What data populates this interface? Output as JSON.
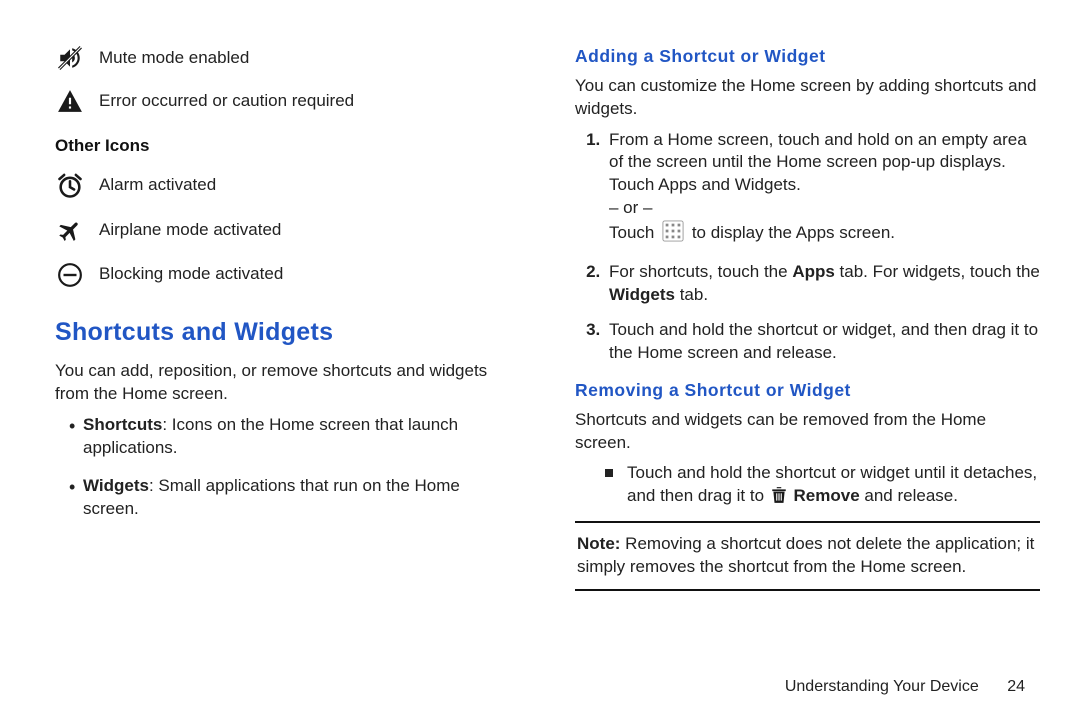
{
  "left": {
    "muteRow": "Mute mode enabled",
    "errorRow": "Error occurred or caution required",
    "otherHeading": "Other Icons",
    "alarmRow": "Alarm activated",
    "airplaneRow": "Airplane mode activated",
    "blockingRow": "Blocking mode activated",
    "shortcutHeading": "Shortcuts and Widgets",
    "shortcutIntro": "You can add, reposition, or remove shortcuts and widgets from the Home screen.",
    "bullet1_b": "Shortcuts",
    "bullet1_t": ": Icons on the Home screen that launch applications.",
    "bullet2_b": "Widgets",
    "bullet2_t": ": Small applications that run on the Home screen."
  },
  "right": {
    "addHeading": "Adding a Shortcut or Widget",
    "addIntro": "You can customize the Home screen by adding shortcuts and widgets.",
    "step1a": "From a Home screen, touch and hold on an empty area of the screen until the Home screen pop-up displays. Touch Apps and Widgets.",
    "orText": "– or –",
    "step1b_pre": "Touch ",
    "step1b_post": " to display the Apps screen.",
    "step2_pre": "For shortcuts, touch the ",
    "step2_apps": "Apps",
    "step2_mid": " tab. For widgets, touch the ",
    "step2_widgets": "Widgets",
    "step2_post": " tab.",
    "step3": "Touch and hold the shortcut or widget, and then drag it to the Home screen and release.",
    "removeHeading": "Removing a Shortcut or Widget",
    "removeIntro": "Shortcuts and widgets can be removed from the Home screen.",
    "removeItem_pre": "Touch and hold the shortcut or widget until it detaches, and then drag it to ",
    "removeItem_b": "Remove",
    "removeItem_post": " and release.",
    "note_b": "Note:",
    "note_t": " Removing a shortcut does not delete the application; it simply removes the shortcut from the Home screen."
  },
  "footer": {
    "section": "Understanding Your Device",
    "page": "24"
  }
}
